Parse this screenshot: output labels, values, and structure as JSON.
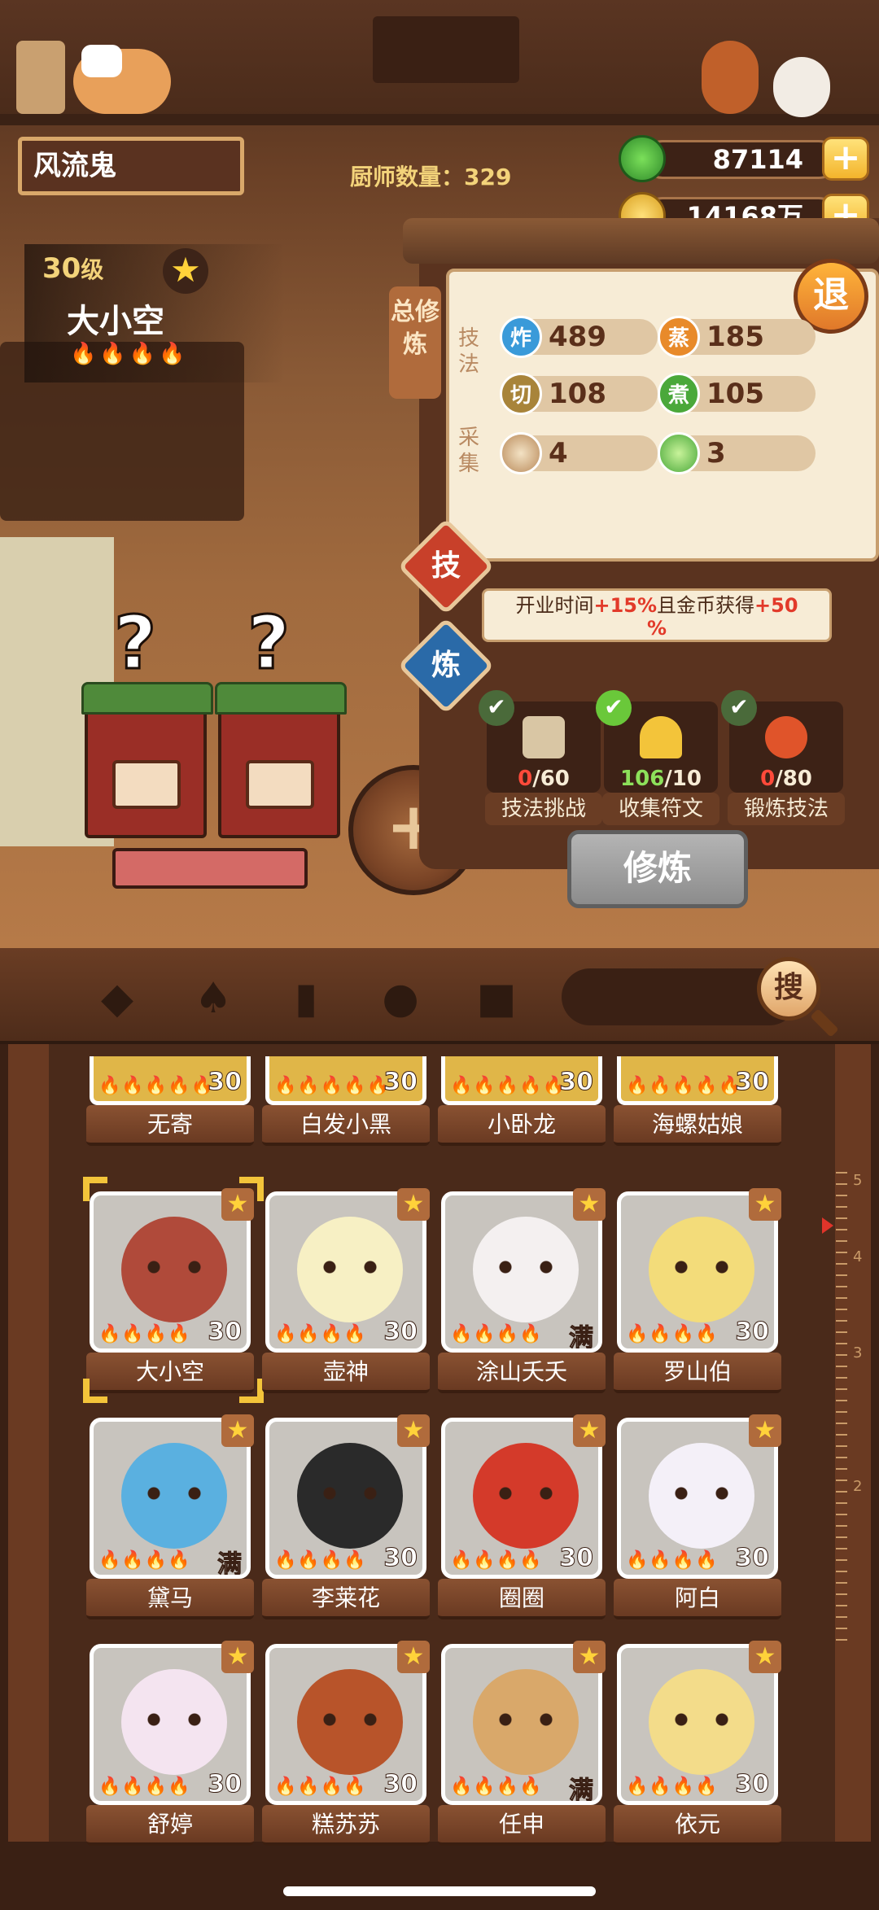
{
  "player": {
    "name": "风流鬼"
  },
  "header": {
    "chef_count_label": "厨师数量：329"
  },
  "currency": {
    "jade": {
      "value": "87114",
      "icon": "jade-coin-icon",
      "color": "#3fae3a"
    },
    "gold": {
      "value": "14168万",
      "icon": "gold-coin-icon",
      "color": "#f3c43a"
    },
    "plus_label": "+"
  },
  "character": {
    "level": "30",
    "level_unit": "级",
    "name": "大小空",
    "flames": "🔥🔥🔥🔥"
  },
  "panel": {
    "total_label": "总修炼",
    "exit_label": "退",
    "skill_section": "技法",
    "gather_section": "采集",
    "skills": [
      {
        "icon_label": "炸",
        "value": "489",
        "color": "#3a9ad9"
      },
      {
        "icon_label": "蒸",
        "value": "185",
        "color": "#e88a2a"
      },
      {
        "icon_label": "切",
        "value": "108",
        "color": "#a8843a"
      },
      {
        "icon_label": "煮",
        "value": "105",
        "color": "#4aa83a"
      }
    ],
    "gather": [
      {
        "icon": "bun-icon",
        "value": "4"
      },
      {
        "icon": "cabbage-icon",
        "value": "3"
      }
    ],
    "tab_skill": "技",
    "tab_refine": "炼",
    "bonus_prefix": "开业时间",
    "bonus_time": "+15%",
    "bonus_mid": "且金币获得",
    "bonus_gold": "+50",
    "bonus_suffix": "%",
    "tasks": [
      {
        "current": "0",
        "total": "/60",
        "label": "技法挑战",
        "icon": "scroll-icon"
      },
      {
        "current": "106",
        "total": "/10",
        "label": "收集符文",
        "icon": "rune-icon"
      },
      {
        "current": "0",
        "total": "/80",
        "label": "锻炼技法",
        "icon": "alarm-clock-icon"
      }
    ],
    "check_mark": "✔",
    "train_label": "修炼"
  },
  "add_label": "+",
  "question_mark": "?",
  "nav": {
    "filters": [
      "spatula-icon",
      "shovel-icon",
      "jar-icon",
      "location-icon",
      "map-icon"
    ],
    "search_label": "搜"
  },
  "ruler": [
    "5",
    "4",
    "3",
    "2"
  ],
  "chefs": [
    {
      "name": "无寄",
      "level": "30",
      "flames": "🔥🔥🔥🔥🔥"
    },
    {
      "name": "白发小黑",
      "level": "30",
      "flames": "🔥🔥🔥🔥🔥"
    },
    {
      "name": "小卧龙",
      "level": "30",
      "flames": "🔥🔥🔥🔥🔥"
    },
    {
      "name": "海螺姑娘",
      "level": "30",
      "flames": "🔥🔥🔥🔥🔥"
    },
    {
      "name": "大小空",
      "level": "30",
      "flames": "🔥🔥🔥🔥"
    },
    {
      "name": "壶神",
      "level": "30",
      "flames": "🔥🔥🔥🔥"
    },
    {
      "name": "涂山夭夭",
      "level": "满",
      "flames": "🔥🔥🔥🔥"
    },
    {
      "name": "罗山伯",
      "level": "30",
      "flames": "🔥🔥🔥🔥"
    },
    {
      "name": "黛马",
      "level": "满",
      "flames": "🔥🔥🔥🔥"
    },
    {
      "name": "李莱花",
      "level": "30",
      "flames": "🔥🔥🔥🔥"
    },
    {
      "name": "圈圈",
      "level": "30",
      "flames": "🔥🔥🔥🔥"
    },
    {
      "name": "阿白",
      "level": "30",
      "flames": "🔥🔥🔥🔥"
    },
    {
      "name": "舒婷",
      "level": "30",
      "flames": "🔥🔥🔥🔥"
    },
    {
      "name": "糕苏苏",
      "level": "30",
      "flames": "🔥🔥🔥🔥"
    },
    {
      "name": "任申",
      "level": "满",
      "flames": "🔥🔥🔥🔥"
    },
    {
      "name": "依元",
      "level": "30",
      "flames": "🔥🔥🔥🔥"
    }
  ],
  "star_glyph": "★"
}
